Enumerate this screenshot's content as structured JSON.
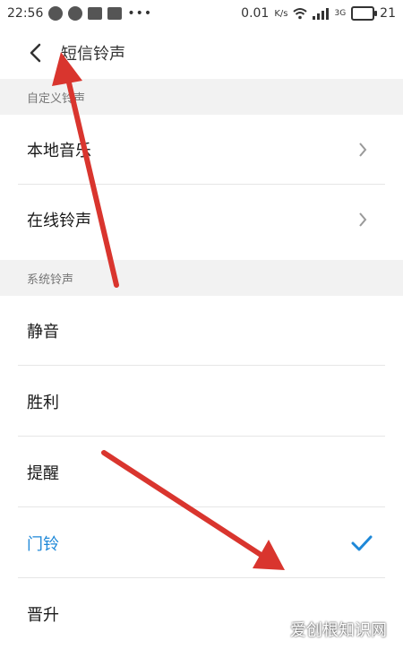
{
  "status_bar": {
    "time": "22:56",
    "speed": "0.01",
    "speed_unit": "K/s",
    "net": "3G",
    "battery": "21"
  },
  "header": {
    "title": "短信铃声"
  },
  "sections": [
    {
      "label": "自定义铃声"
    },
    {
      "label": "系统铃声"
    }
  ],
  "custom_items": [
    {
      "label": "本地音乐"
    },
    {
      "label": "在线铃声"
    }
  ],
  "system_items": [
    {
      "label": "静音"
    },
    {
      "label": "胜利"
    },
    {
      "label": "提醒"
    },
    {
      "label": "门铃",
      "selected": true
    },
    {
      "label": "晋升"
    }
  ],
  "colors": {
    "accent": "#1e88d8",
    "arrow": "#d9352e",
    "section_bg": "#f2f2f2"
  },
  "watermark": "爱创根知识网"
}
